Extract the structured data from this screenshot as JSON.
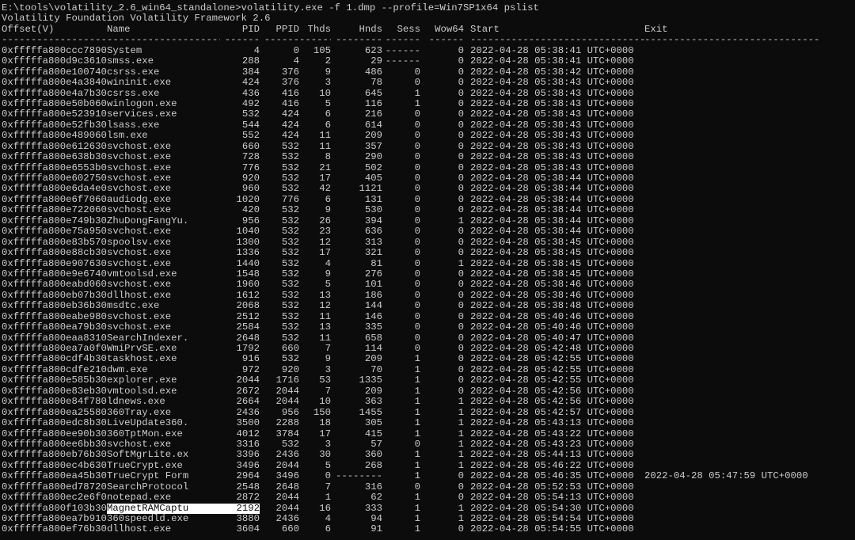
{
  "console": {
    "command_line": "E:\\tools\\volatility_2.6_win64_standalone>volatility.exe -f 1.dmp --profile=Win7SP1x64 pslist",
    "banner": "Volatility Foundation Volatility Framework 2.6"
  },
  "table": {
    "headers": [
      "Offset(V)",
      "Name",
      "PID",
      "PPID",
      "Thds",
      "Hnds",
      "Sess",
      "Wow64",
      "Start",
      "Exit"
    ],
    "separators": [
      "------------------",
      "--------------------",
      "------",
      "------",
      "------",
      "--------",
      "------",
      "------",
      "------------------------------",
      "------------------------------"
    ],
    "rows": [
      [
        "0xfffffa800ccc7890",
        "System",
        "4",
        "0",
        "105",
        "623",
        "------",
        "0",
        "2022-04-28 05:38:41 UTC+0000",
        ""
      ],
      [
        "0xfffffa800d9c3610",
        "smss.exe",
        "288",
        "4",
        "2",
        "29",
        "------",
        "0",
        "2022-04-28 05:38:41 UTC+0000",
        ""
      ],
      [
        "0xfffffa800e100740",
        "csrss.exe",
        "384",
        "376",
        "9",
        "486",
        "0",
        "0",
        "2022-04-28 05:38:42 UTC+0000",
        ""
      ],
      [
        "0xfffffa800e4a3840",
        "wininit.exe",
        "424",
        "376",
        "3",
        "78",
        "0",
        "0",
        "2022-04-28 05:38:43 UTC+0000",
        ""
      ],
      [
        "0xfffffa800e4a7b30",
        "csrss.exe",
        "436",
        "416",
        "10",
        "645",
        "1",
        "0",
        "2022-04-28 05:38:43 UTC+0000",
        ""
      ],
      [
        "0xfffffa800e50b060",
        "winlogon.exe",
        "492",
        "416",
        "5",
        "116",
        "1",
        "0",
        "2022-04-28 05:38:43 UTC+0000",
        ""
      ],
      [
        "0xfffffa800e523910",
        "services.exe",
        "532",
        "424",
        "6",
        "216",
        "0",
        "0",
        "2022-04-28 05:38:43 UTC+0000",
        ""
      ],
      [
        "0xfffffa800e52fb30",
        "lsass.exe",
        "544",
        "424",
        "6",
        "614",
        "0",
        "0",
        "2022-04-28 05:38:43 UTC+0000",
        ""
      ],
      [
        "0xfffffa800e489060",
        "lsm.exe",
        "552",
        "424",
        "11",
        "209",
        "0",
        "0",
        "2022-04-28 05:38:43 UTC+0000",
        ""
      ],
      [
        "0xfffffa800e612630",
        "svchost.exe",
        "660",
        "532",
        "11",
        "357",
        "0",
        "0",
        "2022-04-28 05:38:43 UTC+0000",
        ""
      ],
      [
        "0xfffffa800e638b30",
        "svchost.exe",
        "728",
        "532",
        "8",
        "290",
        "0",
        "0",
        "2022-04-28 05:38:43 UTC+0000",
        ""
      ],
      [
        "0xfffffa800e6553b0",
        "svchost.exe",
        "776",
        "532",
        "21",
        "502",
        "0",
        "0",
        "2022-04-28 05:38:43 UTC+0000",
        ""
      ],
      [
        "0xfffffa800e602750",
        "svchost.exe",
        "920",
        "532",
        "17",
        "405",
        "0",
        "0",
        "2022-04-28 05:38:44 UTC+0000",
        ""
      ],
      [
        "0xfffffa800e6da4e0",
        "svchost.exe",
        "960",
        "532",
        "42",
        "1121",
        "0",
        "0",
        "2022-04-28 05:38:44 UTC+0000",
        ""
      ],
      [
        "0xfffffa800e6f7060",
        "audiodg.exe",
        "1020",
        "776",
        "6",
        "131",
        "0",
        "0",
        "2022-04-28 05:38:44 UTC+0000",
        ""
      ],
      [
        "0xfffffa800e722060",
        "svchost.exe",
        "420",
        "532",
        "9",
        "530",
        "0",
        "0",
        "2022-04-28 05:38:44 UTC+0000",
        ""
      ],
      [
        "0xfffffa800e749b30",
        "ZhuDongFangYu.",
        "956",
        "532",
        "26",
        "394",
        "0",
        "1",
        "2022-04-28 05:38:44 UTC+0000",
        ""
      ],
      [
        "0xfffffa800e75a950",
        "svchost.exe",
        "1040",
        "532",
        "23",
        "636",
        "0",
        "0",
        "2022-04-28 05:38:44 UTC+0000",
        ""
      ],
      [
        "0xfffffa800e83b570",
        "spoolsv.exe",
        "1300",
        "532",
        "12",
        "313",
        "0",
        "0",
        "2022-04-28 05:38:45 UTC+0000",
        ""
      ],
      [
        "0xfffffa800e88cb30",
        "svchost.exe",
        "1336",
        "532",
        "17",
        "321",
        "0",
        "0",
        "2022-04-28 05:38:45 UTC+0000",
        ""
      ],
      [
        "0xfffffa800e907630",
        "svchost.exe",
        "1440",
        "532",
        "4",
        "81",
        "0",
        "1",
        "2022-04-28 05:38:45 UTC+0000",
        ""
      ],
      [
        "0xfffffa800e9e6740",
        "vmtoolsd.exe",
        "1548",
        "532",
        "9",
        "276",
        "0",
        "0",
        "2022-04-28 05:38:45 UTC+0000",
        ""
      ],
      [
        "0xfffffa800eabd060",
        "svchost.exe",
        "1960",
        "532",
        "5",
        "101",
        "0",
        "0",
        "2022-04-28 05:38:46 UTC+0000",
        ""
      ],
      [
        "0xfffffa800eb07b30",
        "dllhost.exe",
        "1612",
        "532",
        "13",
        "186",
        "0",
        "0",
        "2022-04-28 05:38:46 UTC+0000",
        ""
      ],
      [
        "0xfffffa800eb36b30",
        "msdtc.exe",
        "2068",
        "532",
        "12",
        "144",
        "0",
        "0",
        "2022-04-28 05:38:48 UTC+0000",
        ""
      ],
      [
        "0xfffffa800eabe980",
        "svchost.exe",
        "2512",
        "532",
        "11",
        "146",
        "0",
        "0",
        "2022-04-28 05:40:46 UTC+0000",
        ""
      ],
      [
        "0xfffffa800ea79b30",
        "svchost.exe",
        "2584",
        "532",
        "13",
        "335",
        "0",
        "0",
        "2022-04-28 05:40:46 UTC+0000",
        ""
      ],
      [
        "0xfffffa800eaa8310",
        "SearchIndexer.",
        "2648",
        "532",
        "11",
        "658",
        "0",
        "0",
        "2022-04-28 05:40:47 UTC+0000",
        ""
      ],
      [
        "0xfffffa800ea7a0f0",
        "WmiPrvSE.exe",
        "1792",
        "660",
        "7",
        "114",
        "0",
        "0",
        "2022-04-28 05:42:48 UTC+0000",
        ""
      ],
      [
        "0xfffffa800cdf4b30",
        "taskhost.exe",
        "916",
        "532",
        "9",
        "209",
        "1",
        "0",
        "2022-04-28 05:42:55 UTC+0000",
        ""
      ],
      [
        "0xfffffa800cdfe210",
        "dwm.exe",
        "972",
        "920",
        "3",
        "70",
        "1",
        "0",
        "2022-04-28 05:42:55 UTC+0000",
        ""
      ],
      [
        "0xfffffa800e585b30",
        "explorer.exe",
        "2044",
        "1716",
        "53",
        "1335",
        "1",
        "0",
        "2022-04-28 05:42:55 UTC+0000",
        ""
      ],
      [
        "0xfffffa800e83eb30",
        "vmtoolsd.exe",
        "2672",
        "2044",
        "7",
        "209",
        "1",
        "0",
        "2022-04-28 05:42:56 UTC+0000",
        ""
      ],
      [
        "0xfffffa800e84f780",
        "ldnews.exe",
        "2664",
        "2044",
        "10",
        "363",
        "1",
        "1",
        "2022-04-28 05:42:56 UTC+0000",
        ""
      ],
      [
        "0xfffffa800ea25580",
        "360Tray.exe",
        "2436",
        "956",
        "150",
        "1455",
        "1",
        "1",
        "2022-04-28 05:42:57 UTC+0000",
        ""
      ],
      [
        "0xfffffa800edc8b30",
        "LiveUpdate360.",
        "3500",
        "2288",
        "18",
        "305",
        "1",
        "1",
        "2022-04-28 05:43:13 UTC+0000",
        ""
      ],
      [
        "0xfffffa800ee90b30",
        "360TptMon.exe",
        "4012",
        "3784",
        "17",
        "415",
        "1",
        "1",
        "2022-04-28 05:43:22 UTC+0000",
        ""
      ],
      [
        "0xfffffa800ee6bb30",
        "svchost.exe",
        "3316",
        "532",
        "3",
        "57",
        "0",
        "1",
        "2022-04-28 05:43:23 UTC+0000",
        ""
      ],
      [
        "0xfffffa800eb76b30",
        "SoftMgrLite.ex",
        "3396",
        "2436",
        "30",
        "360",
        "1",
        "1",
        "2022-04-28 05:44:13 UTC+0000",
        ""
      ],
      [
        "0xfffffa800ec4b630",
        "TrueCrypt.exe",
        "3496",
        "2044",
        "5",
        "268",
        "1",
        "1",
        "2022-04-28 05:46:22 UTC+0000",
        ""
      ],
      [
        "0xfffffa800ea45b30",
        "TrueCrypt Form",
        "2964",
        "3496",
        "0",
        "--------",
        "1",
        "0",
        "2022-04-28 05:46:35 UTC+0000",
        "2022-04-28 05:47:59 UTC+0000"
      ],
      [
        "0xfffffa800ed78720",
        "SearchProtocol",
        "2548",
        "2648",
        "7",
        "316",
        "0",
        "0",
        "2022-04-28 05:52:53 UTC+0000",
        ""
      ],
      [
        "0xfffffa800ec2e6f0",
        "notepad.exe",
        "2872",
        "2044",
        "1",
        "62",
        "1",
        "0",
        "2022-04-28 05:54:13 UTC+0000",
        ""
      ],
      [
        "0xfffffa800f103b30",
        "MagnetRAMCaptu",
        "2192",
        "2044",
        "16",
        "333",
        "1",
        "1",
        "2022-04-28 05:54:30 UTC+0000",
        ""
      ],
      [
        "0xfffffa800ea7b910",
        "360speedld.exe",
        "3880",
        "2436",
        "4",
        "94",
        "1",
        "1",
        "2022-04-28 05:54:54 UTC+0000",
        ""
      ],
      [
        "0xfffffa800ef76b30",
        "dllhost.exe",
        "3604",
        "660",
        "6",
        "91",
        "1",
        "0",
        "2022-04-28 05:54:55 UTC+0000",
        ""
      ]
    ],
    "highlighted_row_index": 43
  }
}
